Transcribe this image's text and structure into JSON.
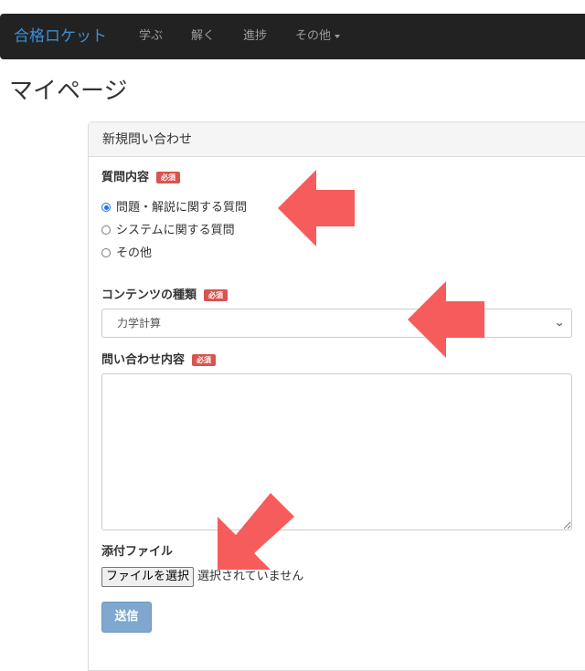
{
  "navbar": {
    "brand": "合格ロケット",
    "items": [
      "学ぶ",
      "解く",
      "進捗",
      "その他"
    ]
  },
  "page_title": "マイページ",
  "panel": {
    "heading": "新規問い合わせ"
  },
  "question_type": {
    "label": "質問内容",
    "required_badge": "必須",
    "options": [
      "問題・解説に関する質問",
      "システムに関する質問",
      "その他"
    ],
    "selected_index": 0
  },
  "content_type": {
    "label": "コンテンツの種類",
    "required_badge": "必須",
    "selected_value": "力学計算"
  },
  "inquiry": {
    "label": "問い合わせ内容",
    "required_badge": "必須",
    "value": ""
  },
  "attachment": {
    "label": "添付ファイル",
    "button_label": "ファイルを選択",
    "status": "選択されていません"
  },
  "submit": {
    "label": "送信"
  },
  "colors": {
    "navbar_bg": "#222222",
    "brand": "#3a8fd6",
    "required_badge": "#d9534f",
    "submit_button": "#7fa7d0",
    "annotation_arrow": "#f75c5c"
  },
  "annotations": {
    "icon": "arrow-icon",
    "count": 3
  }
}
